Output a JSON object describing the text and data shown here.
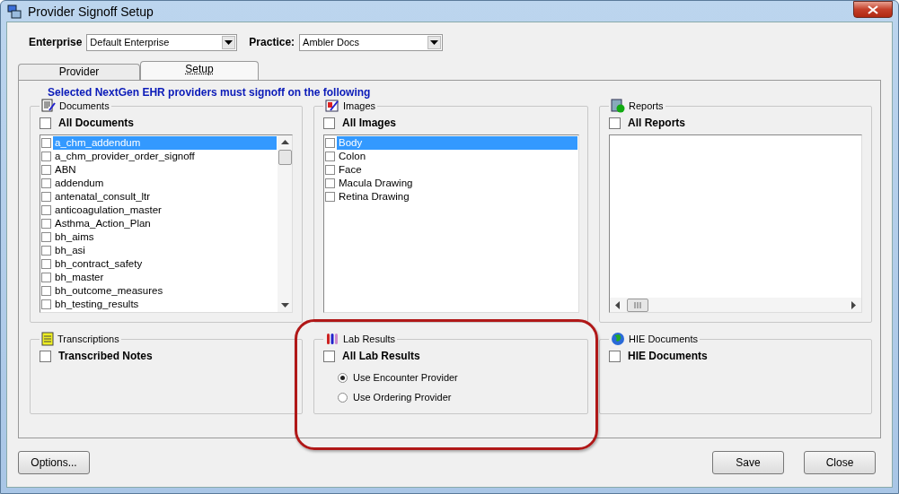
{
  "window": {
    "title": "Provider Signoff Setup"
  },
  "enterprise": {
    "label": "Enterprise",
    "value": "Default Enterprise"
  },
  "practice": {
    "label": "Practice:",
    "value": "Ambler Docs"
  },
  "tabs": [
    {
      "label": "Provider",
      "selected": false
    },
    {
      "label": "Setup",
      "selected": true
    }
  ],
  "heading": "Selected NextGen EHR providers must signoff on the following",
  "documents": {
    "title": "Documents",
    "all": {
      "label": "All Documents",
      "checked": false
    },
    "items": [
      {
        "label": "a_chm_addendum",
        "checked": false,
        "selected": true
      },
      {
        "label": "a_chm_provider_order_signoff",
        "checked": false,
        "selected": false
      },
      {
        "label": "ABN",
        "checked": false,
        "selected": false
      },
      {
        "label": "addendum",
        "checked": false,
        "selected": false
      },
      {
        "label": "antenatal_consult_ltr",
        "checked": false,
        "selected": false
      },
      {
        "label": "anticoagulation_master",
        "checked": false,
        "selected": false
      },
      {
        "label": "Asthma_Action_Plan",
        "checked": false,
        "selected": false
      },
      {
        "label": "bh_aims",
        "checked": false,
        "selected": false
      },
      {
        "label": "bh_asi",
        "checked": false,
        "selected": false
      },
      {
        "label": "bh_contract_safety",
        "checked": false,
        "selected": false
      },
      {
        "label": "bh_master",
        "checked": false,
        "selected": false
      },
      {
        "label": "bh_outcome_measures",
        "checked": false,
        "selected": false
      },
      {
        "label": "bh_testing_results",
        "checked": false,
        "selected": false
      }
    ]
  },
  "images": {
    "title": "Images",
    "all": {
      "label": "All Images",
      "checked": false
    },
    "items": [
      {
        "label": "Body",
        "checked": false,
        "selected": true
      },
      {
        "label": "Colon",
        "checked": false,
        "selected": false
      },
      {
        "label": "Face",
        "checked": false,
        "selected": false
      },
      {
        "label": "Macula Drawing",
        "checked": false,
        "selected": false
      },
      {
        "label": "Retina Drawing",
        "checked": false,
        "selected": false
      }
    ]
  },
  "reports": {
    "title": "Reports",
    "all": {
      "label": "All Reports",
      "checked": false
    }
  },
  "transcriptions": {
    "title": "Transcriptions",
    "all": {
      "label": "Transcribed Notes",
      "checked": false
    }
  },
  "lab_results": {
    "title": "Lab Results",
    "all": {
      "label": "All Lab Results",
      "checked": false
    },
    "options": [
      {
        "label": "Use Encounter Provider",
        "selected": true
      },
      {
        "label": "Use Ordering Provider",
        "selected": false
      }
    ]
  },
  "hie_documents": {
    "title": "HIE Documents",
    "all": {
      "label": "HIE Documents",
      "checked": false
    }
  },
  "buttons": [
    {
      "label": "Options..."
    },
    {
      "label": "Save"
    },
    {
      "label": "Close"
    }
  ]
}
